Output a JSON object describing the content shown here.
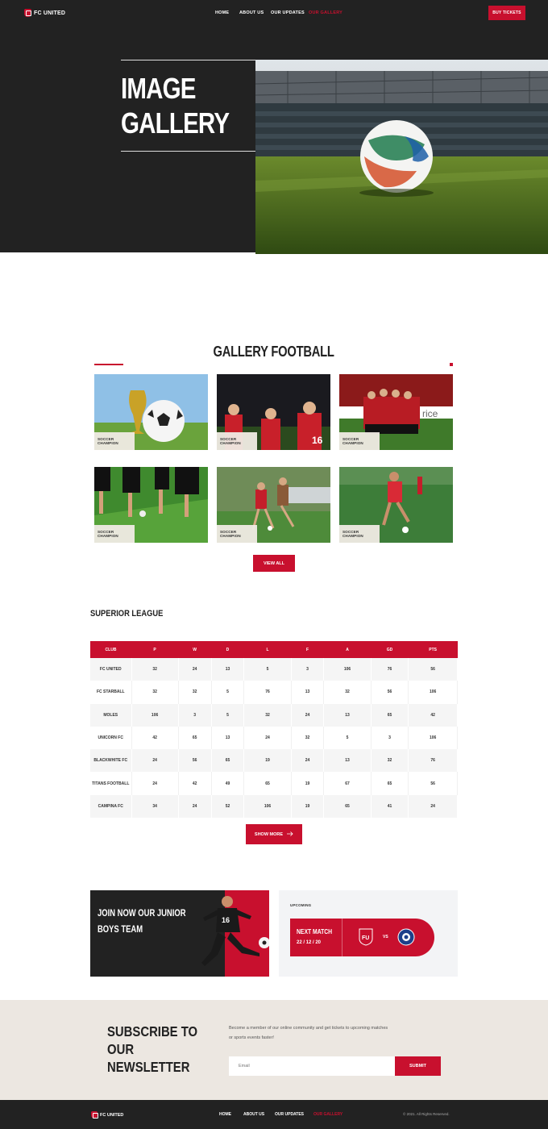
{
  "header": {
    "logo_text": "FC UNITED",
    "nav": [
      "HOME",
      "ABOUT US",
      "OUR UPDATES",
      "OUR GALLERY"
    ],
    "active_nav": "OUR GALLERY",
    "cta": "BUY TICKETS"
  },
  "hero": {
    "title_line1": "IMAGE",
    "title_line2": "GALLERY"
  },
  "gallery": {
    "title": "GALLERY FOOTBALL",
    "items": [
      {
        "caption": "SOCCER CHAMPION"
      },
      {
        "caption": "SOCCER CHAMPION"
      },
      {
        "caption": "SOCCER CHAMPION"
      },
      {
        "caption": "SOCCER CHAMPION"
      },
      {
        "caption": "SOCCER CHAMPION"
      },
      {
        "caption": "SOCCER CHAMPION"
      }
    ],
    "button": "VIEW ALL"
  },
  "league": {
    "title": "SUPERIOR LEAGUE",
    "columns": [
      "CLUB",
      "P",
      "W",
      "D",
      "L",
      "F",
      "A",
      "GD",
      "PTS"
    ],
    "rows": [
      [
        "FC UNITED",
        "32",
        "24",
        "13",
        "5",
        "3",
        "106",
        "76",
        "56"
      ],
      [
        "FC STARBALL",
        "32",
        "32",
        "5",
        "76",
        "13",
        "32",
        "56",
        "106"
      ],
      [
        "MOLES",
        "106",
        "3",
        "5",
        "32",
        "24",
        "13",
        "65",
        "42"
      ],
      [
        "UNICORN FC",
        "42",
        "65",
        "13",
        "24",
        "32",
        "5",
        "3",
        "106"
      ],
      [
        "BLACKWHITE FC",
        "24",
        "56",
        "65",
        "19",
        "24",
        "13",
        "32",
        "76"
      ],
      [
        "TITANS FOOTBALL",
        "24",
        "42",
        "49",
        "65",
        "19",
        "67",
        "65",
        "56"
      ],
      [
        "CAMPINA FC",
        "34",
        "24",
        "52",
        "106",
        "19",
        "65",
        "41",
        "24"
      ]
    ],
    "button": "SHOW MORE"
  },
  "promo": {
    "junior_line1": "JOIN NOW OUR JUNIOR",
    "junior_line2": "BOYS TEAM",
    "jersey_number": "16",
    "upcoming_label": "UPCOMING",
    "next_match_label": "NEXT MATCH",
    "next_match_date": "22 / 12 / 20",
    "vs": "VS"
  },
  "newsletter": {
    "title_line1": "SUBSCRIBE TO OUR",
    "title_line2": "NEWSLETTER",
    "description": "Become a member of our online community and get tickets to upcoming matches or sports events faster!",
    "email_placeholder": "Email",
    "submit": "SUBMIT"
  },
  "footer": {
    "logo_text": "FC UNITED",
    "nav": [
      "HOME",
      "ABOUT US",
      "OUR UPDATES",
      "OUR GALLERY"
    ],
    "active_nav": "OUR GALLERY",
    "copyright": "© 2021. All Rights Reserved."
  },
  "colors": {
    "accent": "#c8102e",
    "dark": "#222222",
    "newsletter_bg": "#ece7e1"
  }
}
